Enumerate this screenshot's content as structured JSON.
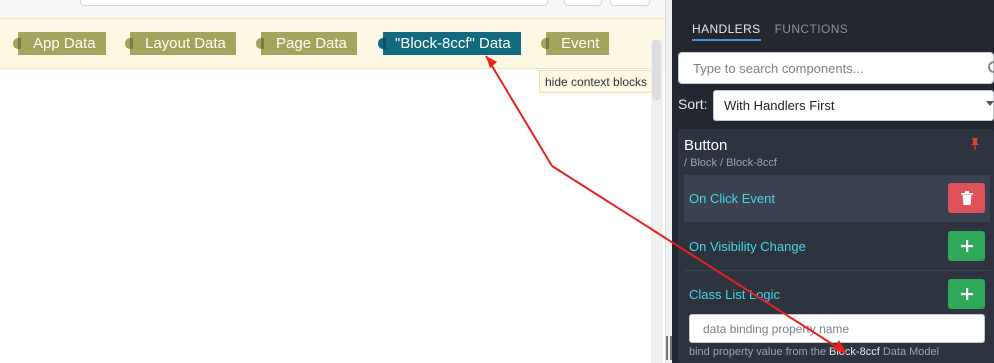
{
  "context_blocks": [
    {
      "label": "App Data",
      "color": "#a2a55b"
    },
    {
      "label": "Layout Data",
      "color": "#a2a55b"
    },
    {
      "label": "Page Data",
      "color": "#a2a55b"
    },
    {
      "label": "\"Block-8ccf\" Data",
      "color": "#126a7f"
    },
    {
      "label": "Event",
      "color": "#a2a55b"
    }
  ],
  "tooltip": "hide context blocks",
  "panel": {
    "tabs": [
      {
        "label": "HANDLERS",
        "active": true
      },
      {
        "label": "FUNCTIONS",
        "active": false
      }
    ],
    "search_placeholder": "Type to search components...",
    "sort_label": "Sort:",
    "sort_value": "With Handlers First",
    "component": {
      "title": "Button",
      "path": "/ Block / Block-8ccf",
      "pin_icon": "pin-icon",
      "handlers": [
        {
          "label": "On Click Event",
          "action": "delete",
          "icon": "trash-icon",
          "active": true
        },
        {
          "label": "On Visibility Change",
          "action": "add",
          "icon": "plus-icon",
          "active": false
        },
        {
          "label": "Class List Logic",
          "action": "add",
          "icon": "plus-icon",
          "active": false
        }
      ],
      "binding_placeholder": "data binding property name",
      "help_prefix": "bind property value from the",
      "help_block": "Block-8ccf",
      "help_suffix": "Data Model"
    }
  },
  "colors": {
    "accent_cyan": "#46d4e8",
    "delete": "#e0525b",
    "add": "#2fa85a",
    "annotation_arrow": "#e8201e"
  }
}
